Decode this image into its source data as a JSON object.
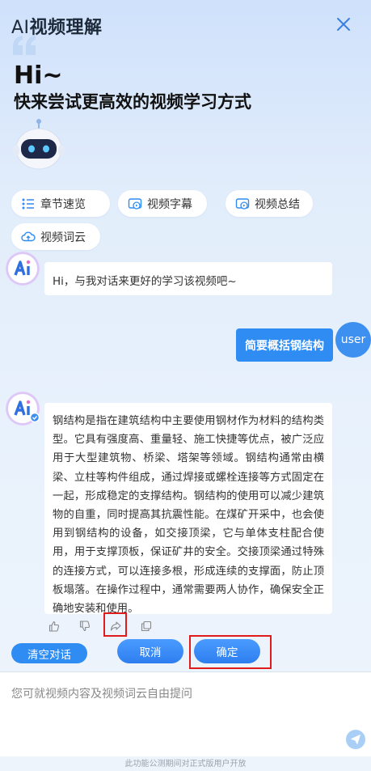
{
  "header": {
    "title_prefix": "AI",
    "title_rest": "视频理解",
    "greeting": "Hi~",
    "subtitle": "快来尝试更高效的视频学习方式"
  },
  "quick_actions": [
    {
      "label": "章节速览",
      "icon": "chapter-list-icon"
    },
    {
      "label": "视频字幕",
      "icon": "video-subtitle-icon"
    },
    {
      "label": "视频总结",
      "icon": "video-summary-icon"
    },
    {
      "label": "视频词云",
      "icon": "cloud-icon"
    }
  ],
  "chat": {
    "greeting_message": "Hi，与我对话来更好的学习该视频吧~",
    "user_message": "简要概括钢结构",
    "user_avatar_label": "user",
    "answer": "钢结构是指在建筑结构中主要使用钢材作为材料的结构类型。它具有强度高、重量轻、施工快捷等优点，被广泛应用于大型建筑物、桥梁、塔架等领域。钢结构通常由横梁、立柱等构件组成，通过焊接或螺栓连接等方式固定在一起，形成稳定的支撑结构。钢结构的使用可以减少建筑物的自重，同时提高其抗震性能。在煤矿开采中，也会使用到钢结构的设备，如交接顶梁，它与单体支柱配合使用，用于支撑顶板，保证矿井的安全。交接顶梁通过特殊的连接方式，可以连接多根，形成连续的支撑面，防止顶板塌落。在操作过程中，通常需要两人协作，确保安全正确地安装和使用。"
  },
  "buttons": {
    "clear": "清空对话",
    "cancel": "取消",
    "confirm": "确定"
  },
  "input": {
    "placeholder": "您可就视频内容及视频词云自由提问"
  },
  "footer": "此功能公测期间对正式版用户开放",
  "colors": {
    "accent": "#2f8cf3",
    "highlight": "#e01b1b"
  }
}
